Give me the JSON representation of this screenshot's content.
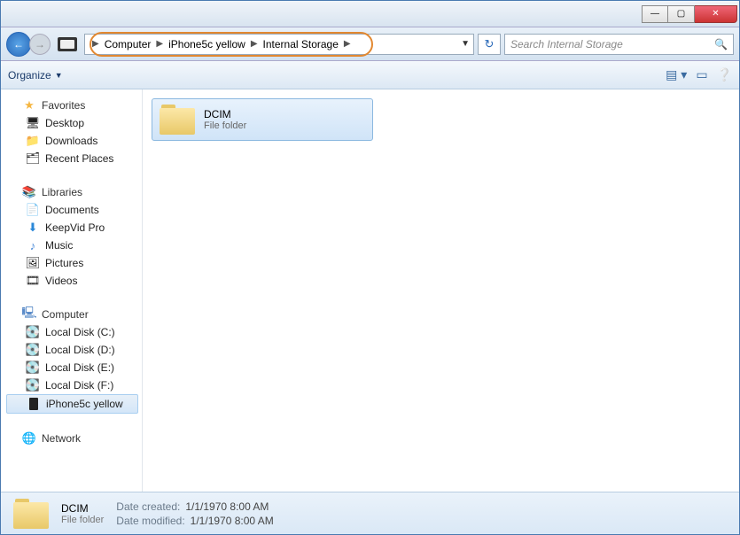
{
  "breadcrumb": [
    "Computer",
    "iPhone5c yellow",
    "Internal Storage"
  ],
  "search": {
    "placeholder": "Search Internal Storage"
  },
  "toolbar": {
    "organize": "Organize"
  },
  "sidebar": {
    "favorites": {
      "label": "Favorites",
      "items": [
        "Desktop",
        "Downloads",
        "Recent Places"
      ]
    },
    "libraries": {
      "label": "Libraries",
      "items": [
        "Documents",
        "KeepVid Pro",
        "Music",
        "Pictures",
        "Videos"
      ]
    },
    "computer": {
      "label": "Computer",
      "items": [
        "Local Disk (C:)",
        "Local Disk (D:)",
        "Local Disk (E:)",
        "Local Disk (F:)",
        "iPhone5c yellow"
      ]
    },
    "network": {
      "label": "Network"
    }
  },
  "content": {
    "folder": {
      "name": "DCIM",
      "type": "File folder"
    }
  },
  "status": {
    "name": "DCIM",
    "type": "File folder",
    "created_label": "Date created:",
    "created_value": "1/1/1970 8:00 AM",
    "modified_label": "Date modified:",
    "modified_value": "1/1/1970 8:00 AM"
  }
}
